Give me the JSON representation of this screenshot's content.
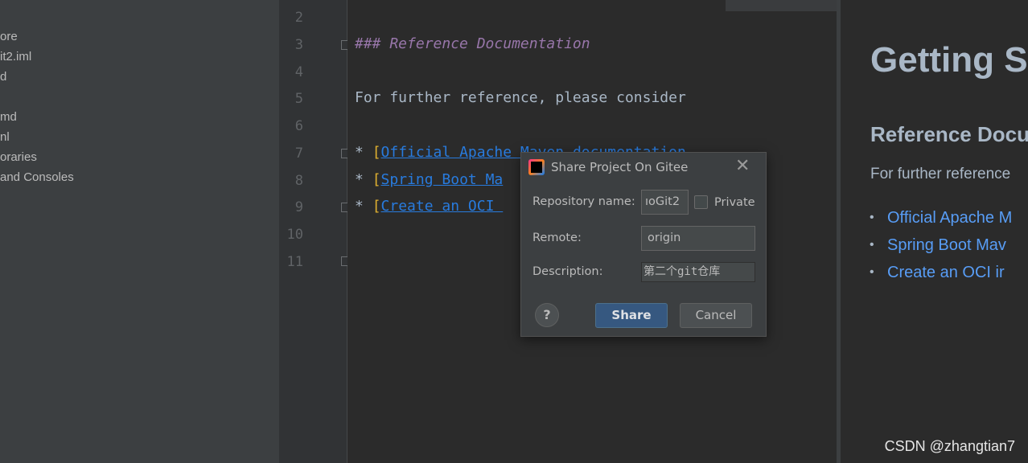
{
  "project_tree": {
    "items": [
      "ore",
      "it2.iml",
      "d",
      "",
      "md",
      "nl",
      "oraries",
      "and Consoles"
    ]
  },
  "editor": {
    "line_numbers": [
      "2",
      "3",
      "4",
      "5",
      "6",
      "7",
      "8",
      "9",
      "10",
      "11"
    ],
    "lines": {
      "heading": "### Reference Documentation",
      "text": "For further reference, please consider",
      "bullet": "* ",
      "open_bracket": "[",
      "link1": "Official Apache Maven documentation",
      "link2": "Spring Boot Ma",
      "link3": "Create an OCI "
    }
  },
  "preview": {
    "title": "Getting S",
    "subtitle": "Reference Docu",
    "text": "For further reference",
    "links": [
      "Official Apache M",
      "Spring Boot Mav",
      "Create an OCI ir"
    ]
  },
  "dialog": {
    "title": "Share Project On Gitee",
    "repo_label": "Repository name:",
    "repo_value": "ıoGit2",
    "private_label": "Private",
    "private_checked": false,
    "remote_label": "Remote:",
    "remote_value": "origin",
    "description_label": "Description:",
    "description_value": "第二个git仓库",
    "share_label": "Share",
    "cancel_label": "Cancel",
    "help_label": "?"
  },
  "watermark": "CSDN @zhangtian7",
  "colors": {
    "accent": "#365880",
    "link": "#287bde",
    "heading": "#9876aa"
  }
}
